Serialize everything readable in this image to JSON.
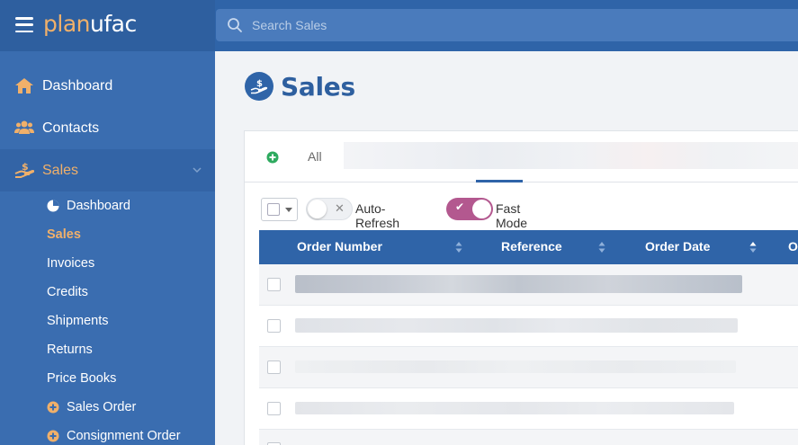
{
  "brand": {
    "part1": "plan",
    "part2": "ufac"
  },
  "search": {
    "placeholder": "Search Sales"
  },
  "sidebar": {
    "items": [
      {
        "label": "Dashboard",
        "icon": "home-icon"
      },
      {
        "label": "Contacts",
        "icon": "users-icon"
      },
      {
        "label": "Sales",
        "icon": "hand-holding-dollar-icon",
        "active": true
      }
    ],
    "sub_items": [
      {
        "label": "Dashboard",
        "icon": "pie-chart-icon"
      },
      {
        "label": "Sales",
        "active": true
      },
      {
        "label": "Invoices"
      },
      {
        "label": "Credits"
      },
      {
        "label": "Shipments"
      },
      {
        "label": "Returns"
      },
      {
        "label": "Price Books"
      },
      {
        "label": "Sales Order",
        "icon": "plus-circle-icon"
      },
      {
        "label": "Consignment Order",
        "icon": "plus-circle-icon"
      }
    ]
  },
  "page": {
    "title": "Sales"
  },
  "tabs": {
    "all_label": "All"
  },
  "toolbar": {
    "auto_refresh_label": "Auto-Refresh",
    "auto_refresh_on": false,
    "fast_mode_label": "Fast Mode",
    "fast_mode_on": true
  },
  "table": {
    "columns": [
      "Order Number",
      "Reference",
      "Order Date",
      "O"
    ]
  },
  "colors": {
    "header_bg": "#2f64a8",
    "sidebar_bg": "#3a6db0",
    "accent": "#f0b06a",
    "toggle_on": "#b3588f"
  }
}
